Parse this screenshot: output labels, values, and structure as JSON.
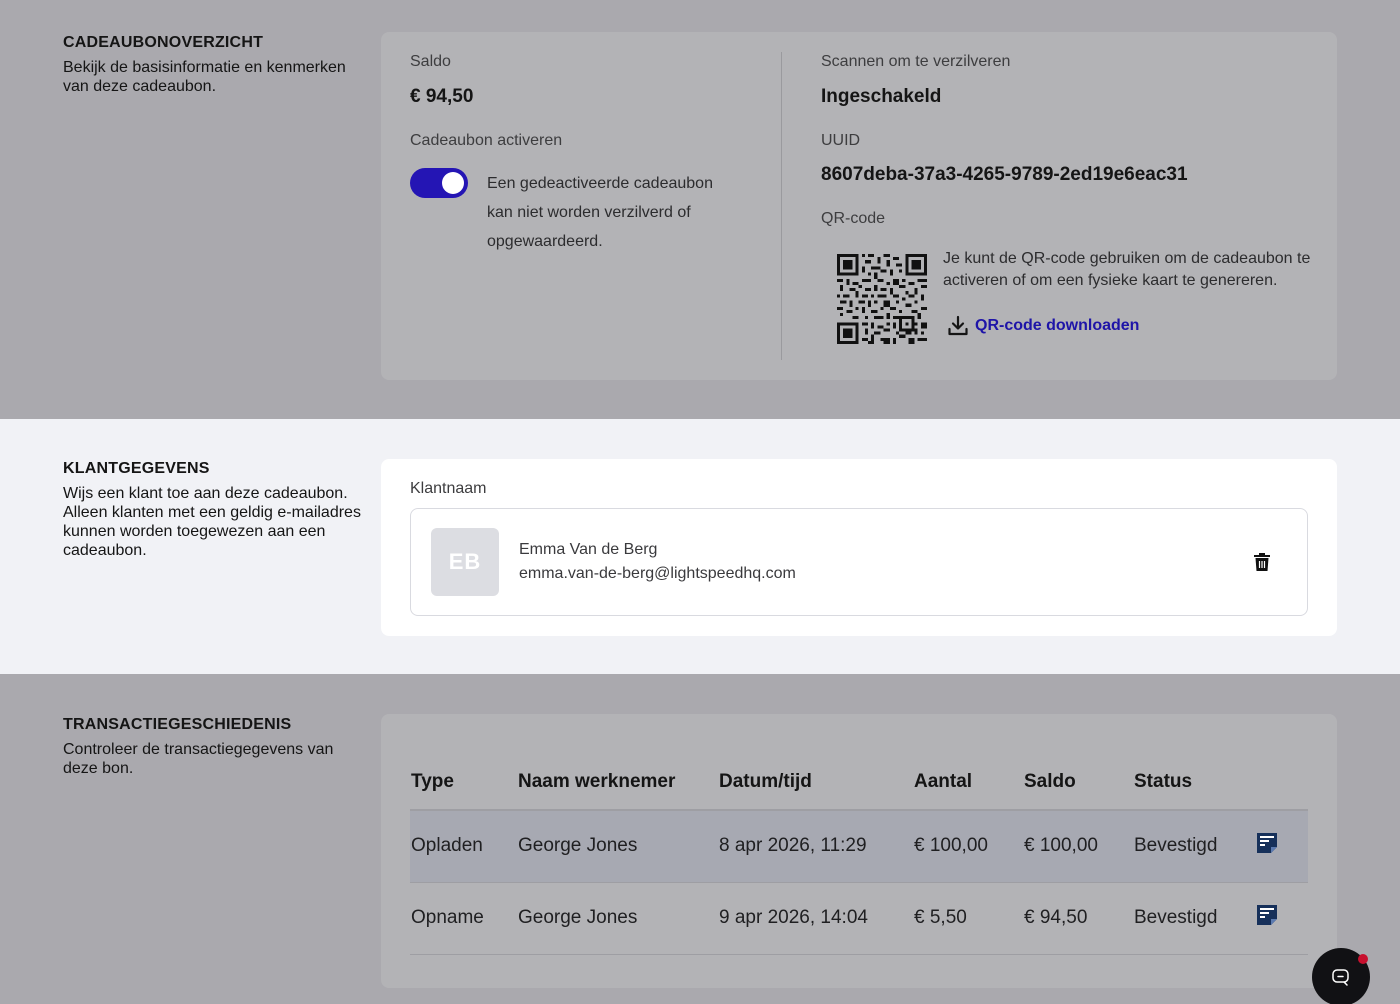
{
  "overview": {
    "title": "CADEAUBONOVERZICHT",
    "desc": "Bekijk de basisinformatie en kenmerken van deze cadeaubon.",
    "balance_label": "Saldo",
    "balance_value": "€ 94,50",
    "activate_label": "Cadeaubon activeren",
    "activate_on": true,
    "activate_help": "Een gedeactiveerde cadeaubon kan niet worden verzilverd of opgewaardeerd.",
    "scan_label": "Scannen om te verzilveren",
    "scan_value": "Ingeschakeld",
    "uuid_label": "UUID",
    "uuid_value": "8607deba-37a3-4265-9789-2ed19e6eac31",
    "qr_label": "QR-code",
    "qr_desc": "Je kunt de QR-code gebruiken om de cadeaubon te activeren of om een fysieke kaart te genereren.",
    "qr_download": "QR-code downloaden"
  },
  "customer": {
    "title": "KLANTGEGEVENS",
    "desc": "Wijs een klant toe aan deze cadeaubon. Alleen klanten met een geldig e-mailadres kunnen worden toegewezen aan een cadeaubon.",
    "name_label": "Klantnaam",
    "initials": "EB",
    "name": "Emma Van de Berg",
    "email": "emma.van-de-berg@lightspeedhq.com"
  },
  "transactions": {
    "title": "TRANSACTIEGESCHIEDENIS",
    "desc": "Controleer de transactiegegevens van deze bon.",
    "headers": [
      "Type",
      "Naam werknemer",
      "Datum/tijd",
      "Aantal",
      "Saldo",
      "Status"
    ],
    "rows": [
      [
        "Opladen",
        "George Jones",
        "8 apr 2026, 11:29",
        "€ 100,00",
        "€ 100,00",
        "Bevestigd"
      ],
      [
        "Opname",
        "George Jones",
        "9 apr 2026, 14:04",
        "€ 5,50",
        "€ 94,50",
        "Bevestigd"
      ]
    ]
  },
  "colors": {
    "accent": "#2415b4",
    "link": "#1e14a8",
    "notification": "#c8102e"
  }
}
